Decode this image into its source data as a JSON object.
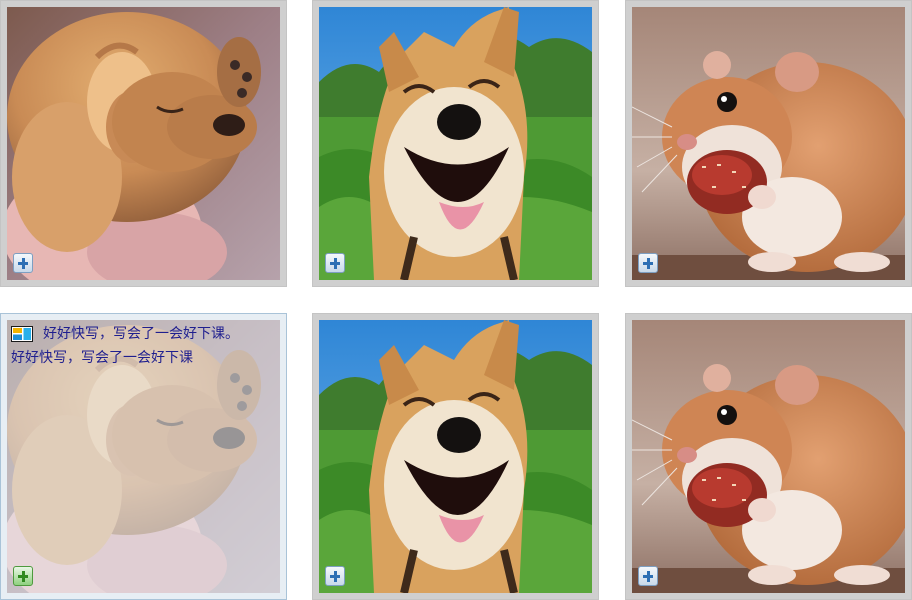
{
  "gallery": {
    "tiles": [
      {
        "subject": "puppy"
      },
      {
        "subject": "shiba-inu"
      },
      {
        "subject": "hamster"
      },
      {
        "subject": "puppy"
      },
      {
        "subject": "shiba-inu"
      },
      {
        "subject": "hamster"
      }
    ],
    "add_icon": "plus-icon",
    "hover_caption": {
      "icon": "layout-icon",
      "line1": "好好快写，写会了一会好下课。",
      "line2": "好好快写，写会了一会好下课"
    }
  },
  "colors": {
    "tile_frame": "#cfcfcf",
    "caption_text": "#1f1f8f",
    "add_blue": "#2d6fb4",
    "add_green": "#2f8a1e"
  }
}
